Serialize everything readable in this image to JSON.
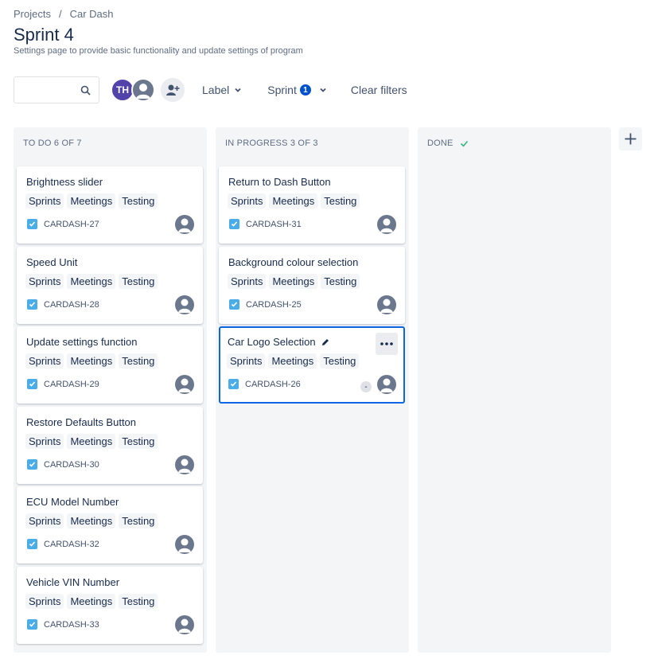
{
  "breadcrumb": {
    "projects": "Projects",
    "separator": "/",
    "project": "Car Dash"
  },
  "page": {
    "title": "Sprint 4",
    "subtitle": "Settings page to provide basic functionality and update settings of program"
  },
  "toolbar": {
    "search_placeholder": "",
    "avatar_initials": "TH",
    "label_filter": "Label",
    "sprint_filter": "Sprint",
    "sprint_badge": "1",
    "clear_filters": "Clear filters"
  },
  "columns": {
    "todo": {
      "header": "TO DO 6 OF 7",
      "cards": [
        {
          "title": "Brightness slider",
          "labels": [
            "Sprints",
            "Meetings",
            "Testing"
          ],
          "key": "CARDASH-27"
        },
        {
          "title": "Speed Unit",
          "labels": [
            "Sprints",
            "Meetings",
            "Testing"
          ],
          "key": "CARDASH-28"
        },
        {
          "title": "Update settings function",
          "labels": [
            "Sprints",
            "Meetings",
            "Testing"
          ],
          "key": "CARDASH-29"
        },
        {
          "title": "Restore Defaults Button",
          "labels": [
            "Sprints",
            "Meetings",
            "Testing"
          ],
          "key": "CARDASH-30"
        },
        {
          "title": "ECU Model Number",
          "labels": [
            "Sprints",
            "Meetings",
            "Testing"
          ],
          "key": "CARDASH-32"
        },
        {
          "title": "Vehicle VIN Number",
          "labels": [
            "Sprints",
            "Meetings",
            "Testing"
          ],
          "key": "CARDASH-33"
        }
      ]
    },
    "in_progress": {
      "header": "IN PROGRESS 3 OF 3",
      "cards": [
        {
          "title": "Return to Dash Button",
          "labels": [
            "Sprints",
            "Meetings",
            "Testing"
          ],
          "key": "CARDASH-31"
        },
        {
          "title": "Background colour selection",
          "labels": [
            "Sprints",
            "Meetings",
            "Testing"
          ],
          "key": "CARDASH-25"
        },
        {
          "title": "Car Logo Selection",
          "labels": [
            "Sprints",
            "Meetings",
            "Testing"
          ],
          "key": "CARDASH-26",
          "estimate": "-"
        }
      ]
    },
    "done": {
      "header": "DONE"
    }
  },
  "colors": {
    "accent": "#0052cc",
    "selected_border": "#0c66e4",
    "avatar_th": "#5243aa",
    "done_check": "#36b37e",
    "story_check": "#4bade8"
  },
  "icons": [
    "search-icon",
    "add-user-icon",
    "chevron-down-icon",
    "check-icon",
    "checkbox-icon",
    "user-icon",
    "more-icon",
    "edit-icon",
    "plus-icon"
  ]
}
